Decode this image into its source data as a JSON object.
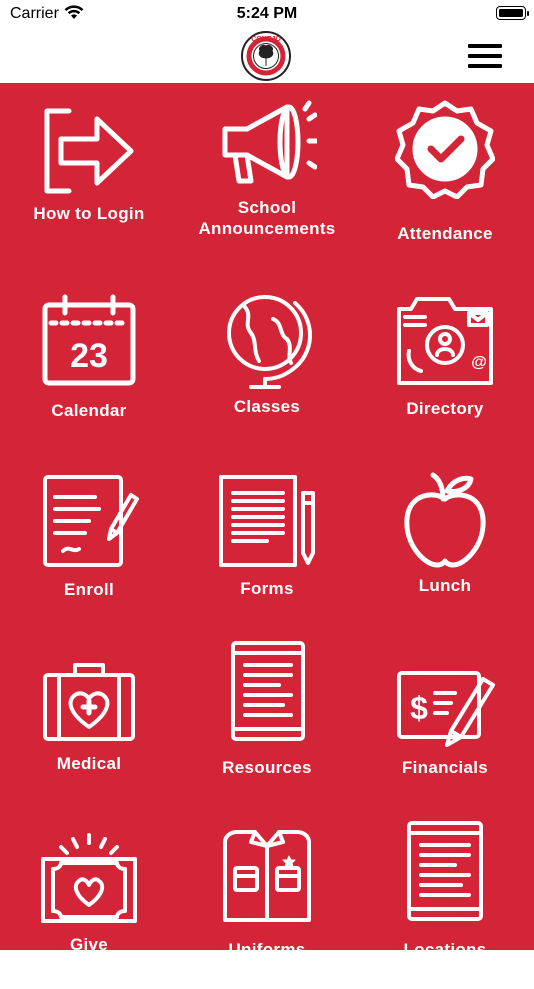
{
  "status": {
    "carrier": "Carrier",
    "time": "5:24 PM"
  },
  "header": {
    "logo_text": "CONEJO"
  },
  "colors": {
    "brand_red": "#d42437",
    "white": "#ffffff"
  },
  "tiles": [
    {
      "label": "How to Login",
      "icon": "login-arrow-icon"
    },
    {
      "label": "School Announcements",
      "icon": "megaphone-icon"
    },
    {
      "label": "Attendance",
      "icon": "check-badge-icon"
    },
    {
      "label": "Calendar",
      "icon": "calendar-icon",
      "day": "23"
    },
    {
      "label": "Classes",
      "icon": "globe-icon"
    },
    {
      "label": "Directory",
      "icon": "contact-card-icon"
    },
    {
      "label": "Enroll",
      "icon": "document-pen-icon"
    },
    {
      "label": "Forms",
      "icon": "forms-pencil-icon"
    },
    {
      "label": "Lunch",
      "icon": "apple-icon"
    },
    {
      "label": "Medical",
      "icon": "medical-kit-icon"
    },
    {
      "label": "Resources",
      "icon": "tablet-icon"
    },
    {
      "label": "Financials",
      "icon": "check-pen-icon"
    },
    {
      "label": "Give",
      "icon": "heart-banknote-icon"
    },
    {
      "label": "Uniforms",
      "icon": "shirt-icon"
    },
    {
      "label": "Locations",
      "icon": "tablet-list-icon"
    }
  ]
}
